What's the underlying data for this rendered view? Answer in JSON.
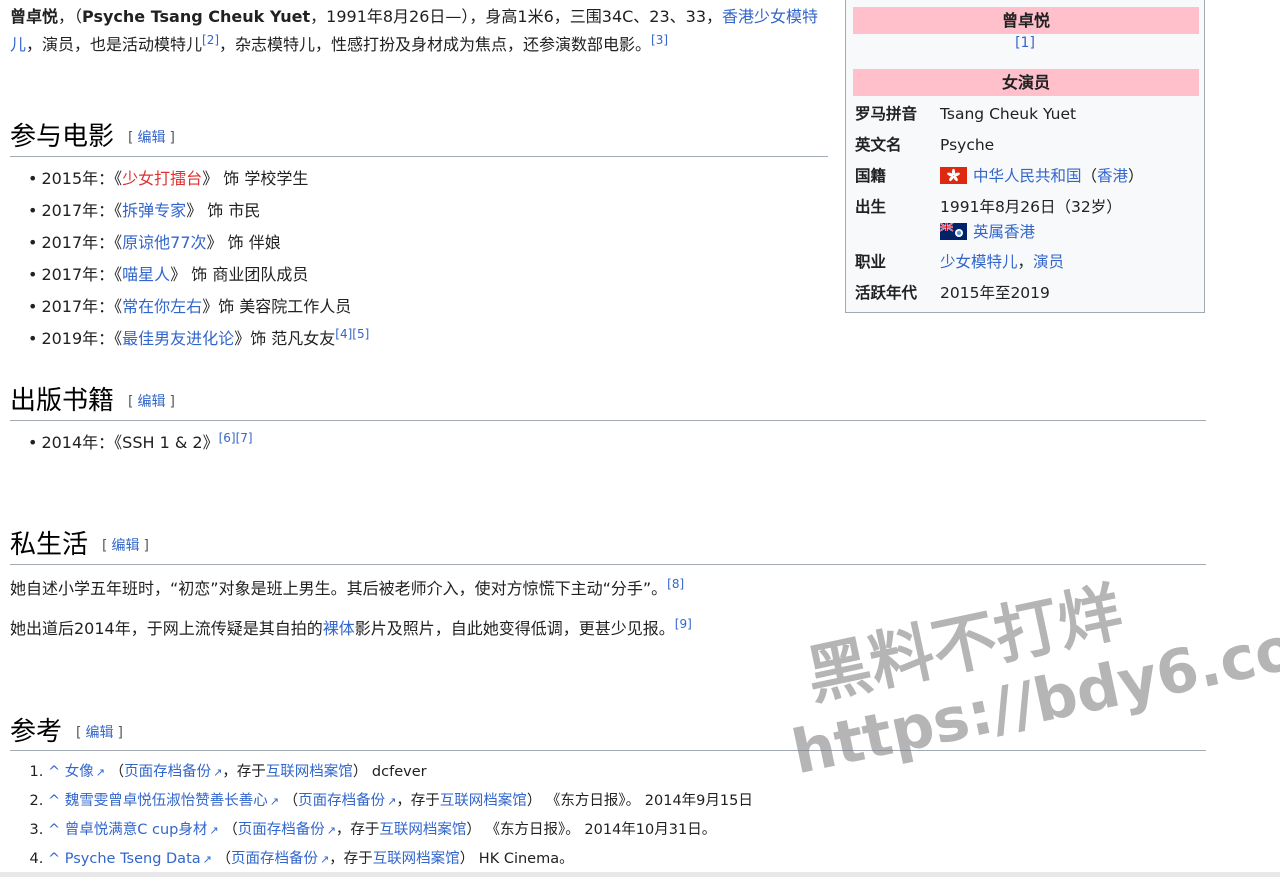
{
  "lead": {
    "name": "曾卓悦",
    "text1": "，（",
    "english": "Psyche Tsang Cheuk Yuet",
    "text2": "，1991年8月26日—），身高1米6，三围34C、23、33，",
    "link_model": "香港少女模特儿",
    "text3": "，演员，也是活动模特儿",
    "ref2": "[2]",
    "text4": "，杂志模特儿，性感打扮及身材成为焦点，还参演数部电影。",
    "ref3": "[3]"
  },
  "sections": {
    "films": {
      "title": "参与电影",
      "edit": "编辑"
    },
    "books": {
      "title": "出版书籍",
      "edit": "编辑"
    },
    "personal": {
      "title": "私生活",
      "edit": "编辑"
    },
    "refs": {
      "title": "参考",
      "edit": "编辑"
    }
  },
  "films": [
    {
      "year": "2015年：《",
      "title": "少女打擂台",
      "rest": "》 饰 学校学生",
      "refs": ""
    },
    {
      "year": "2017年：《",
      "title": "拆弹专家",
      "rest": "》 饰 市民",
      "refs": ""
    },
    {
      "year": "2017年：《",
      "title": "原谅他77次",
      "rest": "》 饰 伴娘",
      "refs": ""
    },
    {
      "year": "2017年：《",
      "title": "喵星人",
      "rest": "》 饰 商业团队成员",
      "refs": ""
    },
    {
      "year": "2017年：《",
      "title": "常在你左右",
      "rest": "》饰 美容院工作人员",
      "refs": ""
    },
    {
      "year": "2019年：《",
      "title": "最佳男友进化论",
      "rest": "》饰 范凡女友",
      "refs": "[4][5]"
    }
  ],
  "books": [
    {
      "text": "2014年：《SSH 1 & 2》",
      "refs": "[6][7]"
    }
  ],
  "personal": [
    {
      "text_a": "她自述小学五年班时，“初恋”对象是班上男生。其后被老师介入，使对方惊慌下主动“分手”。",
      "link": "",
      "text_b": "",
      "ref": "[8]"
    },
    {
      "text_a": "她出道后2014年，于网上流传疑是其自拍的",
      "link": "裸体",
      "text_b": "影片及照片，自此她变得低调，更甚少见报。",
      "ref": "[9]"
    }
  ],
  "references": [
    {
      "caret": "^",
      "title": "女像",
      "archive": "页面存档备份",
      "stored": "，存于",
      "wayback": "互联网档案馆",
      "source": "dcfever",
      "date": ""
    },
    {
      "caret": "^",
      "title": "魏雪雯曾卓悦伍淑怡赞善长善心",
      "archive": "页面存档备份",
      "stored": "，存于",
      "wayback": "互联网档案馆",
      "source": "《东方日报》。",
      "date": "2014年9月15日"
    },
    {
      "caret": "^",
      "title": "曾卓悦满意C cup身材",
      "archive": "页面存档备份",
      "stored": "，存于",
      "wayback": "互联网档案馆",
      "source": "《东方日报》。",
      "date": "2014年10月31日。"
    },
    {
      "caret": "^",
      "title": "Psyche Tseng Data",
      "archive": "页面存档备份",
      "stored": "，存于",
      "wayback": "互联网档案馆",
      "source": "HK Cinema。",
      "date": ""
    }
  ],
  "infobox": {
    "name": "曾卓悦",
    "name_ref": "[1]",
    "role": "女演员",
    "rows": {
      "romanization": {
        "label": "罗马拼音",
        "value": "Tsang Cheuk Yuet"
      },
      "english": {
        "label": "英文名",
        "value": "Psyche"
      },
      "nationality": {
        "label": "国籍",
        "link": "中华人民共和国",
        "paren_open": "（",
        "link2": "香港",
        "paren_close": "）"
      },
      "born": {
        "label": "出生",
        "value": "1991年8月26日（32岁）",
        "place": "英属香港"
      },
      "occupation": {
        "label": "职业",
        "link1": "少女模特儿",
        "sep": "，",
        "link2": "演员"
      },
      "active": {
        "label": "活跃年代",
        "value": "2015年至2019"
      }
    }
  },
  "watermark": {
    "line1": "黑料不打烊",
    "line2": "https://bdy6.co"
  },
  "colors": {
    "link": "#3366cc",
    "redlink": "#dd3333",
    "infobox_header": "#ffc0cb"
  },
  "icons": {
    "external": "external-link-icon",
    "flag_hk": "hong-kong-flag-icon",
    "flag_colonial": "british-hong-kong-flag-icon"
  }
}
